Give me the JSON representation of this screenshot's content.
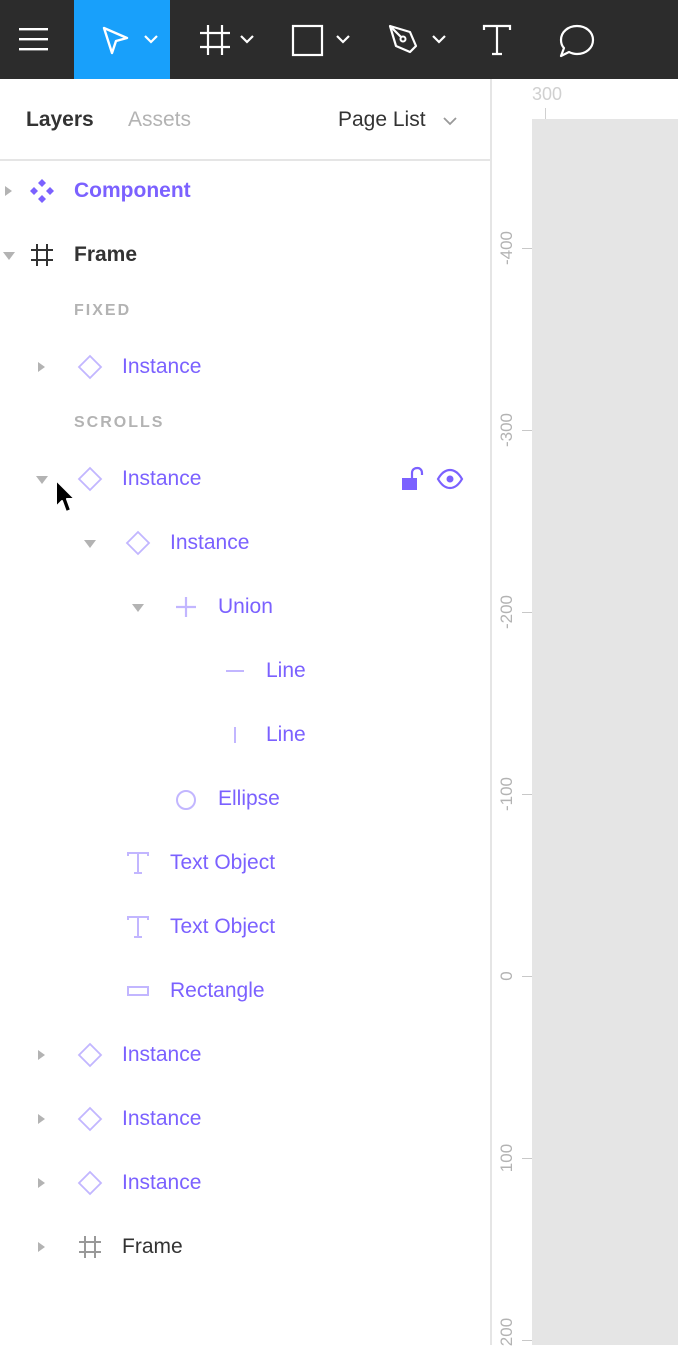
{
  "toolbar": {
    "menu_icon": "hamburger-menu-icon",
    "tools": [
      "move-tool-icon",
      "frame-tool-icon",
      "rectangle-tool-icon",
      "pen-tool-icon",
      "text-tool-icon",
      "comment-tool-icon"
    ],
    "active_color": "#18a0fb"
  },
  "panel": {
    "tabs": [
      "Layers",
      "Assets"
    ],
    "page_list": "Page List"
  },
  "layers": {
    "component": "Component",
    "frame": "Frame",
    "fixed_label": "FIXED",
    "fixed_instance": "Instance",
    "scrolls_label": "SCROLLS",
    "instance_selected": "Instance",
    "instance_nested": "Instance",
    "union": "Union",
    "line_1": "Line",
    "line_2": "Line",
    "ellipse": "Ellipse",
    "text_object_1": "Text Object",
    "text_object_2": "Text Object",
    "rectangle": "Rectangle",
    "instance_a": "Instance",
    "instance_b": "Instance",
    "instance_c": "Instance",
    "frame_bottom": "Frame"
  },
  "ruler": {
    "top_label": "300",
    "left_labels": [
      "-400",
      "-300",
      "-200",
      "-100",
      "0",
      "100",
      "200"
    ]
  },
  "colors": {
    "accent": "#7b61ff",
    "toolbar_bg": "#2c2c2c",
    "canvas_bg": "#e5e5e5"
  }
}
